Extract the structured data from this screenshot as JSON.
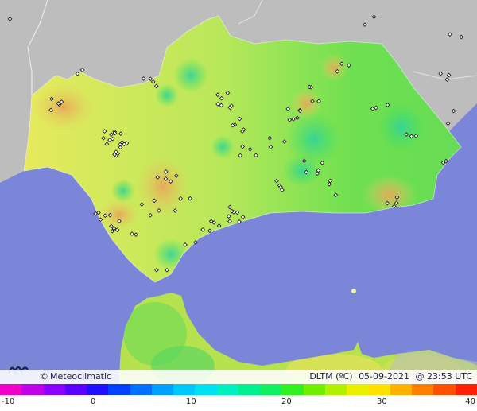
{
  "caption": {
    "copyright_symbol": "©",
    "brand": "Meteoclimatic",
    "variable": "DLTM (ºC)",
    "date": "05-09-2021",
    "time": "@ 23:53 UTC"
  },
  "legend": {
    "ticks": [
      "-10",
      "0",
      "10",
      "20",
      "30",
      "40"
    ],
    "min": -10,
    "max": 40,
    "colors": [
      "#f000c8",
      "#c000e8",
      "#8c00ff",
      "#5a00ff",
      "#1e10ff",
      "#0040ff",
      "#0070ff",
      "#00a0ff",
      "#00c8ff",
      "#00e0f0",
      "#00f0c0",
      "#00f090",
      "#10f060",
      "#30f020",
      "#70f000",
      "#b0f000",
      "#e8f000",
      "#ffe000",
      "#ffb000",
      "#ff8000",
      "#ff5000",
      "#ff2000"
    ]
  },
  "map": {
    "region": "Andalucía",
    "colors": {
      "sea": "#7b86d8",
      "land_outside": "#bdbdbd",
      "andalucia_base": "#9fe548",
      "warm_zone": "#e6eb5a",
      "hot_spot": "#e6b85a",
      "cool_spot": "#43db6f"
    },
    "station_count": 150
  }
}
